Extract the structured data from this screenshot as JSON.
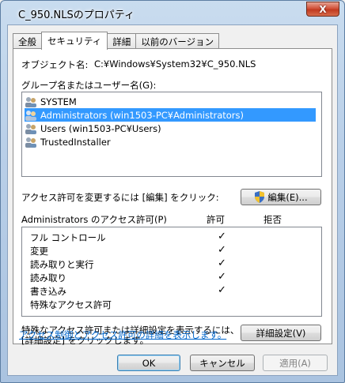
{
  "window": {
    "title": "C_950.NLSのプロパティ",
    "close_label": "X"
  },
  "tabs": [
    {
      "label": "全般",
      "active": false
    },
    {
      "label": "セキュリティ",
      "active": true
    },
    {
      "label": "詳細",
      "active": false
    },
    {
      "label": "以前のバージョン",
      "active": false
    }
  ],
  "object": {
    "label": "オブジェクト名:",
    "value": "C:¥Windows¥System32¥C_950.NLS"
  },
  "groups": {
    "label": "グループ名またはユーザー名(G):",
    "items": [
      {
        "name": "SYSTEM",
        "selected": false
      },
      {
        "name": "Administrators (win1503-PC¥Administrators)",
        "selected": true
      },
      {
        "name": "Users (win1503-PC¥Users)",
        "selected": false
      },
      {
        "name": "TrustedInstaller",
        "selected": false
      }
    ]
  },
  "edit": {
    "prompt": "アクセス許可を変更するには [編集] をクリック:",
    "button_label": "編集(E)..."
  },
  "permissions": {
    "header": "Administrators のアクセス許可(P)",
    "allow_header": "許可",
    "deny_header": "拒否",
    "rows": [
      {
        "name": "フル コントロール",
        "allow": "✓",
        "deny": ""
      },
      {
        "name": "変更",
        "allow": "✓",
        "deny": ""
      },
      {
        "name": "読み取りと実行",
        "allow": "✓",
        "deny": ""
      },
      {
        "name": "読み取り",
        "allow": "✓",
        "deny": ""
      },
      {
        "name": "書き込み",
        "allow": "✓",
        "deny": ""
      },
      {
        "name": "特殊なアクセス許可",
        "allow": "",
        "deny": ""
      }
    ]
  },
  "advanced": {
    "text_line1": "特殊なアクセス許可または詳細設定を表示するには、",
    "text_line2": "[詳細設定] をクリックします。",
    "button_label": "詳細設定(V)"
  },
  "learn_more_link": "アクセス制御とアクセス許可の詳細を表示します。",
  "footer": {
    "ok_label": "OK",
    "cancel_label": "キャンセル",
    "apply_label": "適用(A)"
  }
}
